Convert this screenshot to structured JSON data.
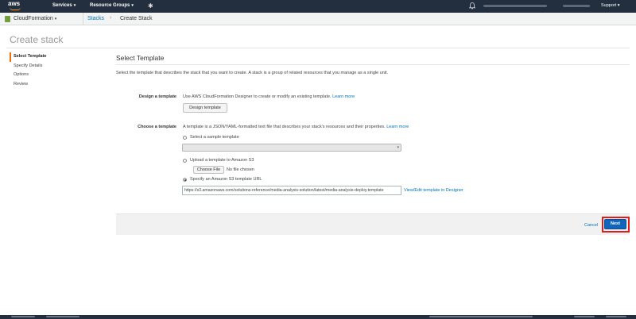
{
  "topnav": {
    "logo_text": "aws",
    "services": "Services",
    "resource_groups": "Resource Groups",
    "support": "Support"
  },
  "breadcrumb": {
    "service": "CloudFormation",
    "stacks": "Stacks",
    "current": "Create Stack"
  },
  "page_title": "Create stack",
  "steps": [
    "Select Template",
    "Specify Details",
    "Options",
    "Review"
  ],
  "active_step": "Select Template",
  "section": {
    "title": "Select Template",
    "description": "Select the template that describes the stack that you want to create. A stack is a group of related resources that you manage as a single unit."
  },
  "design": {
    "label": "Design a template",
    "text": "Use AWS CloudFormation Designer to create or modify an existing template.",
    "learn_more": "Learn more",
    "button": "Design template"
  },
  "choose": {
    "label": "Choose a template",
    "text": "A template is a JSON/YAML-formatted text file that describes your stack's resources and their properties.",
    "learn_more": "Learn more",
    "option_sample": "Select a sample template",
    "option_upload": "Upload a template to Amazon S3",
    "choose_file": "Choose File",
    "no_file": "No file chosen",
    "option_url": "Specify an Amazon S3 template URL",
    "url_value": "https://s3.amazonaws.com/solutions-reference/media-analysis-solution/latest/media-analysis-deploy.template",
    "view_edit": "View/Edit template in Designer",
    "selected_option": "option_url"
  },
  "actions": {
    "cancel": "Cancel",
    "next": "Next"
  },
  "colors": {
    "nav_bg": "#232f3e",
    "accent_orange": "#ec7211",
    "link_blue": "#0073bb",
    "primary_button": "#1166bb",
    "highlight_red": "#e01b1b"
  }
}
